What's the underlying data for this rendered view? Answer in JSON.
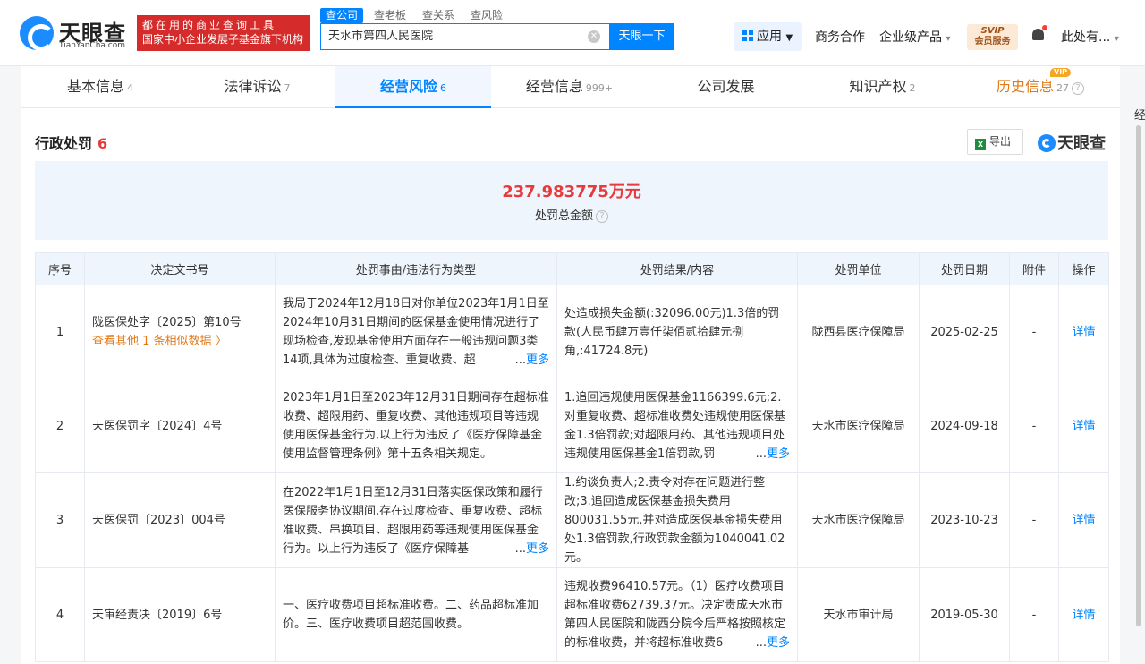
{
  "header": {
    "logo_name": "天眼查",
    "logo_site": "TianYanCha.com",
    "slogan_line1": "都在用的商业查询工具",
    "slogan_line2": "国家中小企业发展子基金旗下机构",
    "search_tabs": [
      "查公司",
      "查老板",
      "查关系",
      "查风险"
    ],
    "search_value": "天水市第四人民医院",
    "search_button": "天眼一下",
    "app_label": "应用",
    "nav_business": "商务合作",
    "nav_enterprise": "企业级产品",
    "svip_line1": "SVIP",
    "svip_line2": "会员服务",
    "user_label": "此处有..."
  },
  "tabs": [
    {
      "label": "基本信息",
      "count": "4"
    },
    {
      "label": "法律诉讼",
      "count": "7"
    },
    {
      "label": "经营风险",
      "count": "6"
    },
    {
      "label": "经营信息",
      "count": "999+"
    },
    {
      "label": "公司发展",
      "count": ""
    },
    {
      "label": "知识产权",
      "count": "2"
    },
    {
      "label": "历史信息",
      "count": "27"
    }
  ],
  "vip_tag": "VIP",
  "section": {
    "title": "行政处罚",
    "count": "6",
    "export_label": "导出",
    "brand": "天眼查",
    "total_amount": "237.983775万元",
    "total_label": "处罚总金额"
  },
  "table": {
    "headers": [
      "序号",
      "决定文书号",
      "处罚事由/违法行为类型",
      "处罚结果/内容",
      "处罚单位",
      "处罚日期",
      "附件",
      "操作"
    ],
    "more_label": "更多",
    "detail_label": "详情",
    "rows": [
      {
        "index": "1",
        "doc": "陇医保处字〔2025〕第10号",
        "similar": "查看其他 1 条相似数据",
        "reason": "我局于2024年12月18日对你单位2023年1月1日至2024年10月31日期间的医保基金使用情况进行了现场检查,发现基金使用方面存在一般违规问题3类14项,具体为过度检查、重复收费、超",
        "result": "处造成损失金额(:32096.00元)1.3倍的罚款(人民币肆万壹仟柒佰贰拾肆元捌角,:41724.8元)",
        "unit": "陇西县医疗保障局",
        "date": "2025-02-25",
        "attachment": "-"
      },
      {
        "index": "2",
        "doc": "天医保罚字〔2024〕4号",
        "similar": "",
        "reason": "2023年1月1日至2023年12月31日期间存在超标准收费、超限用药、重复收费、其他违规项目等违规使用医保基金行为,以上行为违反了《医疗保障基金使用监督管理条例》第十五条相关规定。",
        "result": "1.追回违规使用医保基金1166399.6元;2.对重复收费、超标准收费处违规使用医保基金1.3倍罚款;对超限用药、其他违规项目处违规使用医保基金1倍罚款,罚",
        "unit": "天水市医疗保障局",
        "date": "2024-09-18",
        "attachment": "-"
      },
      {
        "index": "3",
        "doc": "天医保罚〔2023〕004号",
        "similar": "",
        "reason": "在2022年1月1日至12月31日落实医保政策和履行医保服务协议期间,存在过度检查、重复收费、超标准收费、串换项目、超限用药等违规使用医保基金行为。以上行为违反了《医疗保障基",
        "result": "1.约谈负责人;2.责令对存在问题进行整改;3.追回造成医保基金损失费用800031.55元,并对造成医保基金损失费用处1.3倍罚款,行政罚款金额为1040041.02元。",
        "unit": "天水市医疗保障局",
        "date": "2023-10-23",
        "attachment": "-"
      },
      {
        "index": "4",
        "doc": "天审经责决〔2019〕6号",
        "similar": "",
        "reason": "一、医疗收费项目超标准收费。二、药品超标准加价。三、医疗收费项目超范围收费。",
        "result": "违规收费96410.57元。（1）医疗收费项目超标准收费62739.37元。决定责成天水市第四人民医院和陇西分院今后严格按照核定的标准收费，并将超标准收费6",
        "unit": "天水市审计局",
        "date": "2019-05-30",
        "attachment": "-"
      }
    ]
  },
  "edge_text": "经"
}
